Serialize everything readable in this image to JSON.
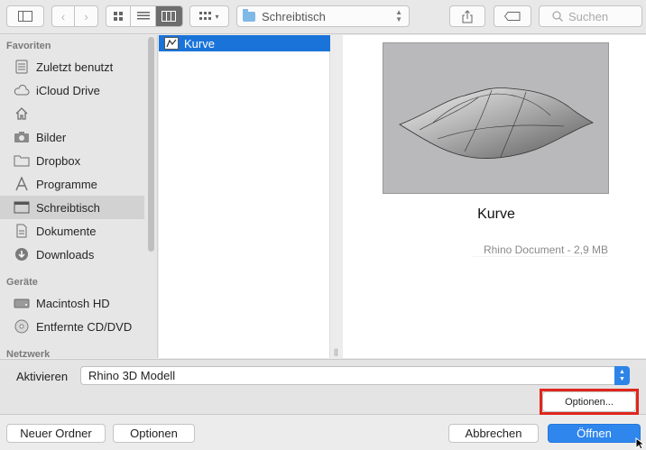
{
  "toolbar": {
    "location": "Schreibtisch",
    "search_placeholder": "Suchen"
  },
  "sidebar": {
    "favorites_header": "Favoriten",
    "favorites": [
      {
        "label": "Zuletzt benutzt",
        "icon": "recents-icon"
      },
      {
        "label": "iCloud Drive",
        "icon": "cloud-icon"
      },
      {
        "label": "",
        "icon": "home-icon"
      },
      {
        "label": "Bilder",
        "icon": "camera-icon"
      },
      {
        "label": "Dropbox",
        "icon": "folder-icon"
      },
      {
        "label": "Programme",
        "icon": "applications-icon"
      },
      {
        "label": "Schreibtisch",
        "icon": "desktop-icon",
        "selected": true
      },
      {
        "label": "Dokumente",
        "icon": "documents-icon"
      },
      {
        "label": "Downloads",
        "icon": "downloads-icon"
      }
    ],
    "devices_header": "Geräte",
    "devices": [
      {
        "label": "Macintosh HD",
        "icon": "harddisk-icon"
      },
      {
        "label": "Entfernte CD/DVD",
        "icon": "disc-icon"
      }
    ],
    "network_header": "Netzwerk"
  },
  "files": [
    {
      "name": "Kurve",
      "selected": true
    }
  ],
  "preview": {
    "name": "Kurve",
    "info": "Rhino Document - 2,9 MB"
  },
  "options": {
    "label": "Aktivieren",
    "selected_format": "Rhino 3D Modell",
    "options_button": "Optionen..."
  },
  "footer": {
    "new_folder": "Neuer Ordner",
    "options": "Optionen",
    "cancel": "Abbrechen",
    "open": "Öffnen"
  },
  "colors": {
    "accent": "#2f86ec",
    "selection": "#1a73d9",
    "highlight_box": "#e0261d"
  }
}
